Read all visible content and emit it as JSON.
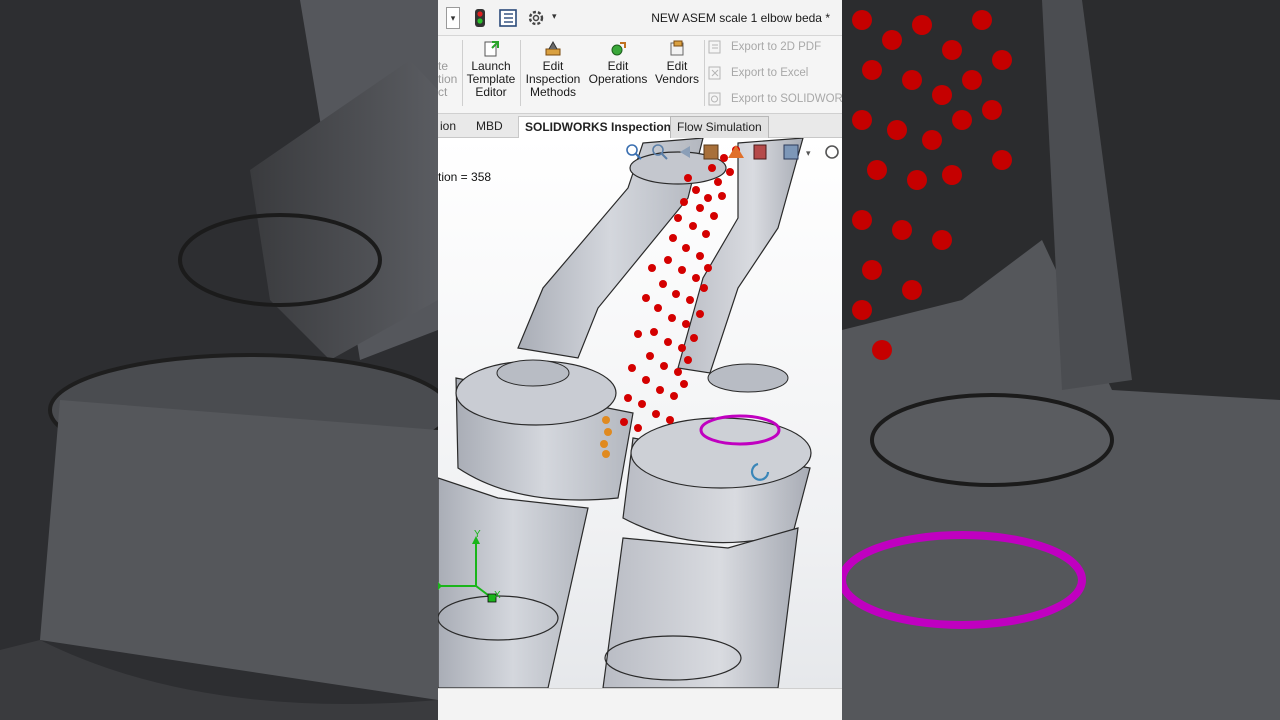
{
  "window": {
    "title": "NEW ASEM scale 1 elbow beda *"
  },
  "ribbon": {
    "partial_labels": [
      "te",
      "tion",
      "ct"
    ],
    "buttons": [
      {
        "label_lines": [
          "Launch",
          "Template",
          "Editor"
        ]
      },
      {
        "label_lines": [
          "Edit",
          "Inspection",
          "Methods"
        ]
      },
      {
        "label_lines": [
          "Edit",
          "Operations"
        ]
      },
      {
        "label_lines": [
          "Edit",
          "Vendors"
        ]
      }
    ],
    "exports": [
      {
        "label": "Export to 2D PDF"
      },
      {
        "label": "Export to Excel"
      },
      {
        "label": "Export to SOLIDWORKS"
      }
    ]
  },
  "tabs": {
    "items": [
      {
        "label": "ion"
      },
      {
        "label": "MBD"
      },
      {
        "label": "SOLIDWORKS Inspection"
      },
      {
        "label": "Flow Simulation"
      }
    ],
    "active_index": 2
  },
  "viewport": {
    "iteration_text": "tion = 358",
    "axis_labels": {
      "y": "Y",
      "x": "X"
    }
  },
  "colors": {
    "particle": "#d40000",
    "part_fill": "#c9ccd3",
    "selection_ring": "#c000c0",
    "axis": "#1ab51a"
  }
}
